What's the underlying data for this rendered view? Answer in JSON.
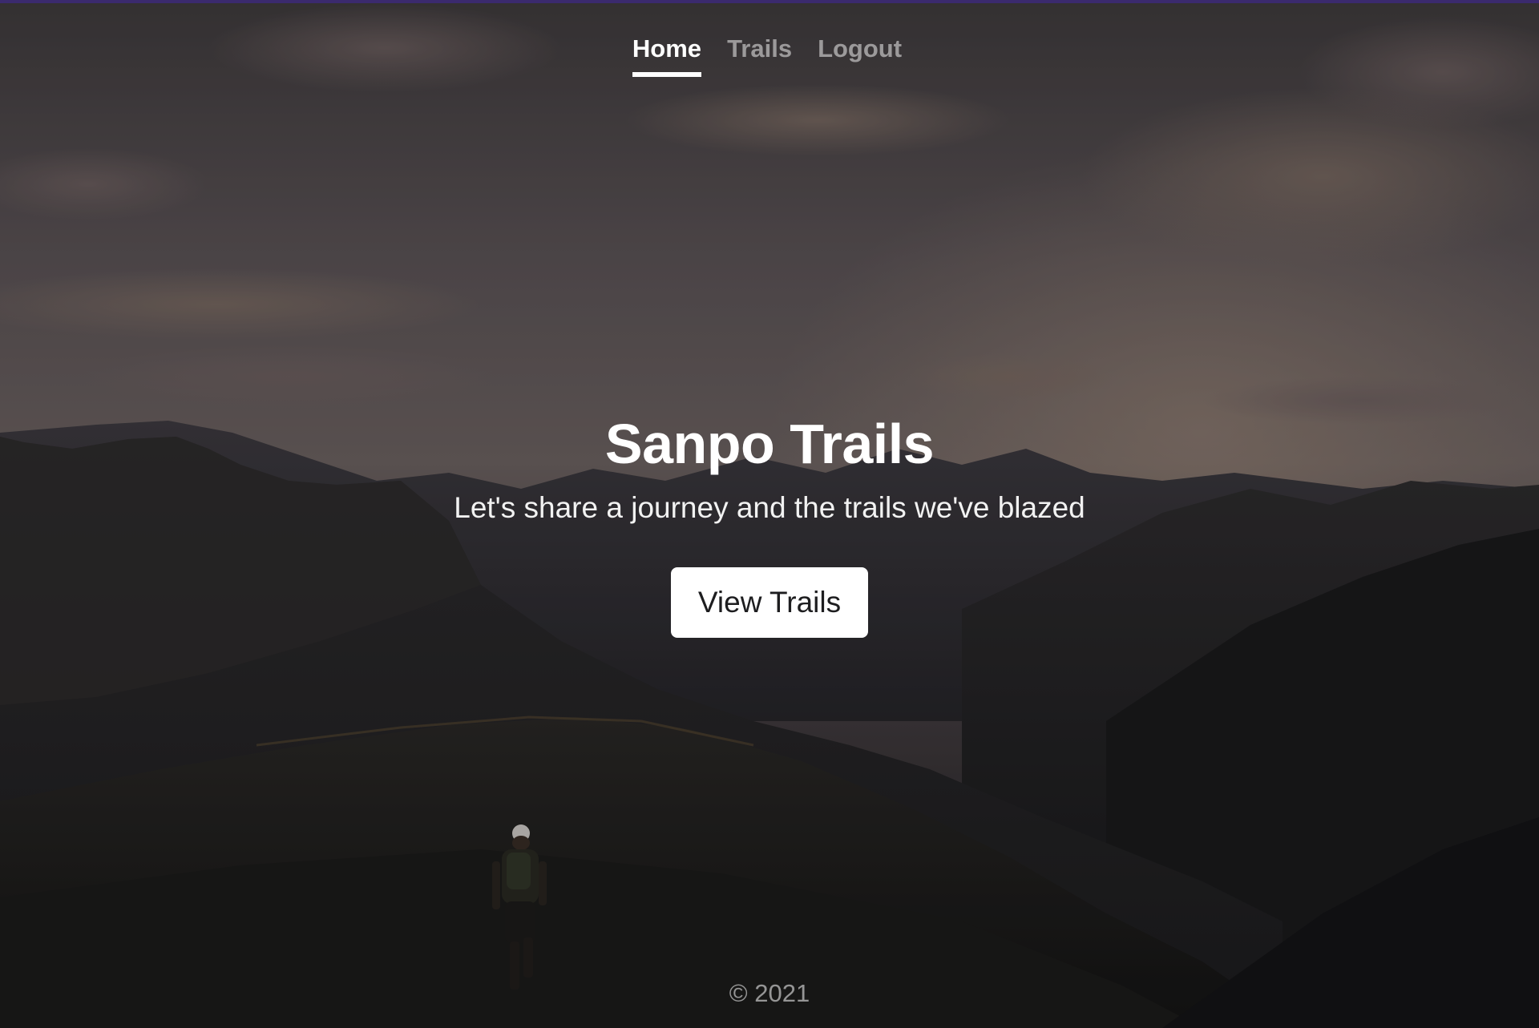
{
  "nav": {
    "items": [
      {
        "label": "Home",
        "active": true
      },
      {
        "label": "Trails",
        "active": false
      },
      {
        "label": "Logout",
        "active": false
      }
    ]
  },
  "hero": {
    "title": "Sanpo Trails",
    "subtitle": "Let's share a journey and the trails we've blazed",
    "cta_label": "View Trails",
    "background": "mountain-sunset-hiker-photo"
  },
  "footer": {
    "copyright": "© 2021"
  },
  "colors": {
    "accent_bar": "#3b2a6e",
    "nav_active": "#ffffff",
    "nav_inactive": "#9a9898",
    "button_bg": "#ffffff",
    "button_text": "#1d1d1f"
  }
}
